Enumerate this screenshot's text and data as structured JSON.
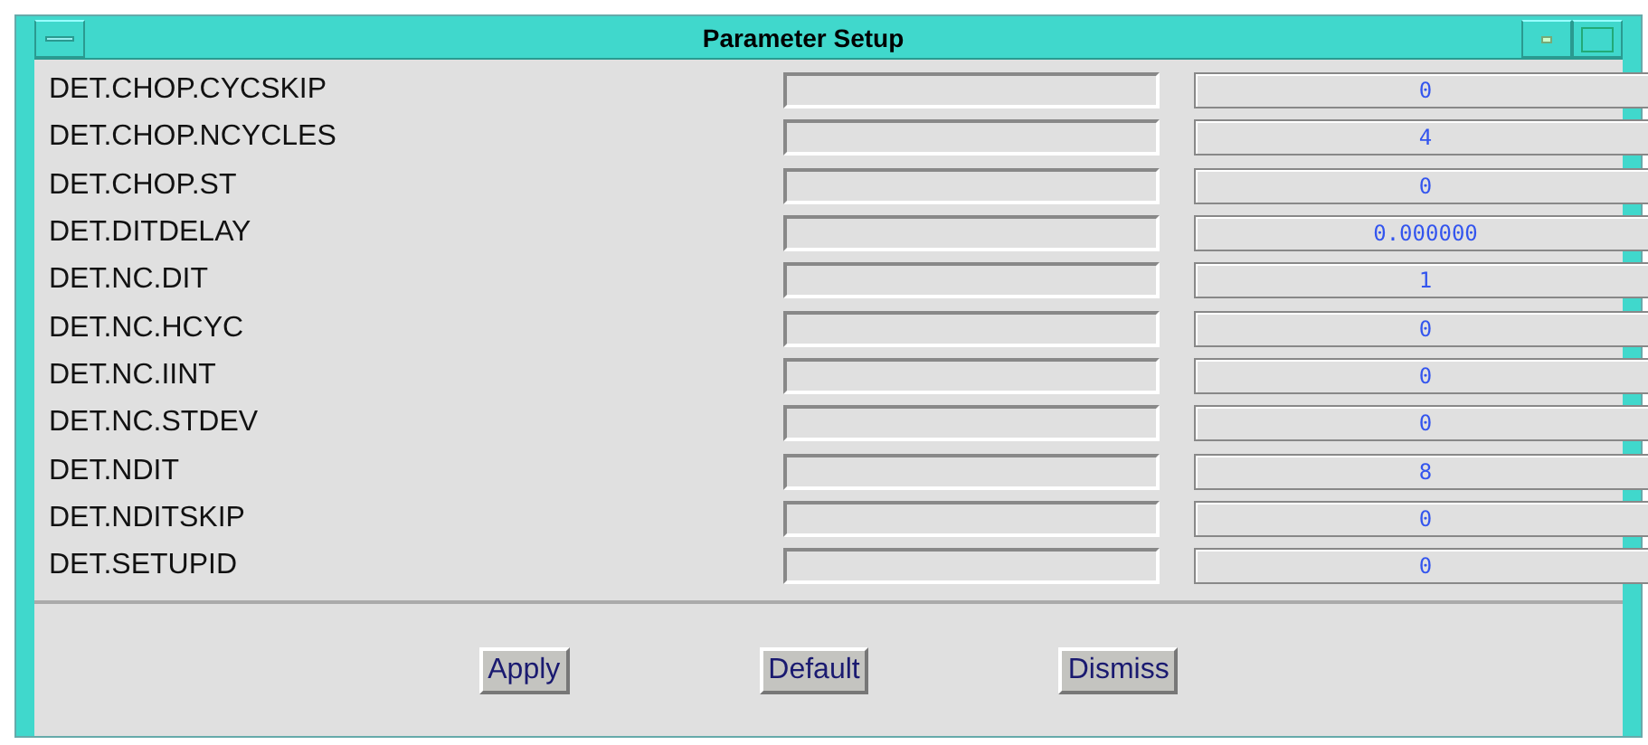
{
  "window": {
    "title": "Parameter Setup"
  },
  "parameters": [
    {
      "name": "DET.CHOP.CYCSKIP",
      "value": "0"
    },
    {
      "name": "DET.CHOP.NCYCLES",
      "value": "4"
    },
    {
      "name": "DET.CHOP.ST",
      "value": "0"
    },
    {
      "name": "DET.DITDELAY",
      "value": "0.000000"
    },
    {
      "name": "DET.NC.DIT",
      "value": "1"
    },
    {
      "name": "DET.NC.HCYC",
      "value": "0"
    },
    {
      "name": "DET.NC.IINT",
      "value": "0"
    },
    {
      "name": "DET.NC.STDEV",
      "value": "0"
    },
    {
      "name": "DET.NDIT",
      "value": "8"
    },
    {
      "name": "DET.NDITSKIP",
      "value": "0"
    },
    {
      "name": "DET.SETUPID",
      "value": "0"
    }
  ],
  "buttons": [
    "Apply",
    "Default",
    "Dismiss"
  ]
}
